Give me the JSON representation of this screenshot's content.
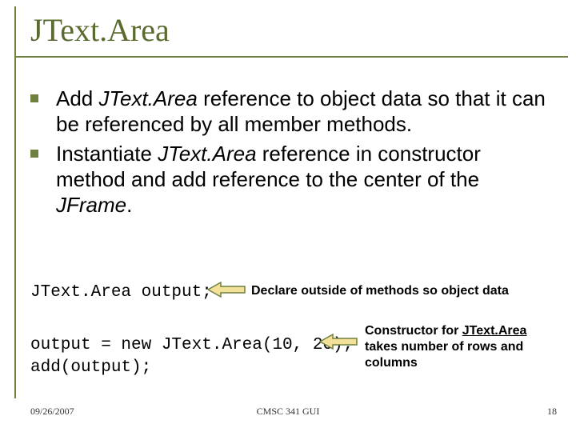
{
  "title": "JText.Area",
  "bullets": [
    {
      "pre": "Add ",
      "em1": "JText.Area",
      "post": " reference to object data so that it can be referenced by all member methods."
    },
    {
      "pre": "Instantiate ",
      "em1": "JText.Area",
      "mid": " reference in constructor method and add reference to the center of the ",
      "em2": "JFrame",
      "post": "."
    }
  ],
  "code": {
    "declare": "JText.Area output;",
    "constructor": [
      "output = new JText.Area(10, 20);",
      "add(output);"
    ]
  },
  "notes": [
    "Declare outside of methods so object data",
    {
      "pre": "Constructor for ",
      "ul": "JText.Area",
      "post": " takes number of rows and columns"
    }
  ],
  "footer": {
    "date": "09/26/2007",
    "center": "CMSC 341 GUI",
    "page": "18"
  },
  "colors": {
    "accent": "#6f8040",
    "arrow_fill": "#f3e19a"
  }
}
